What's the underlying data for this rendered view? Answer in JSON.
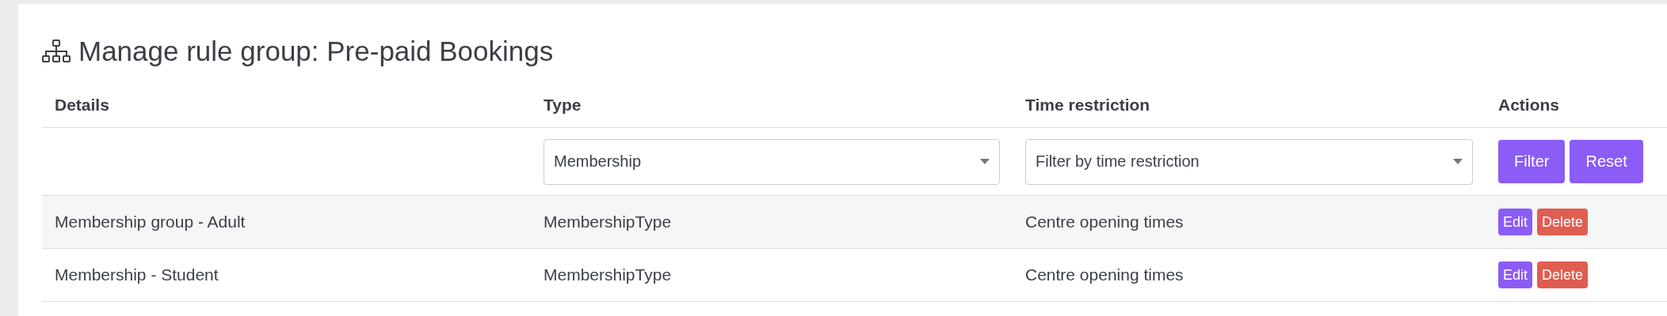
{
  "title": "Manage rule group: Pre-paid Bookings",
  "table": {
    "columns": [
      "Details",
      "Type",
      "Time restriction",
      "Actions"
    ],
    "filters": {
      "type_select": {
        "value": "Membership"
      },
      "time_select": {
        "placeholder": "Filter by time restriction"
      },
      "buttons": [
        "Filter",
        "Reset"
      ]
    },
    "rows": [
      {
        "details": "Membership group - Adult",
        "type": "MembershipType",
        "time_restriction": "Centre opening times",
        "actions": [
          {
            "kind": "edit",
            "label": "Edit"
          },
          {
            "kind": "delete",
            "label": "Delete"
          }
        ]
      },
      {
        "details": "Membership - Student",
        "type": "MembershipType",
        "time_restriction": "Centre opening times",
        "actions": [
          {
            "kind": "edit",
            "label": "Edit"
          },
          {
            "kind": "delete",
            "label": "Delete"
          }
        ]
      }
    ]
  }
}
